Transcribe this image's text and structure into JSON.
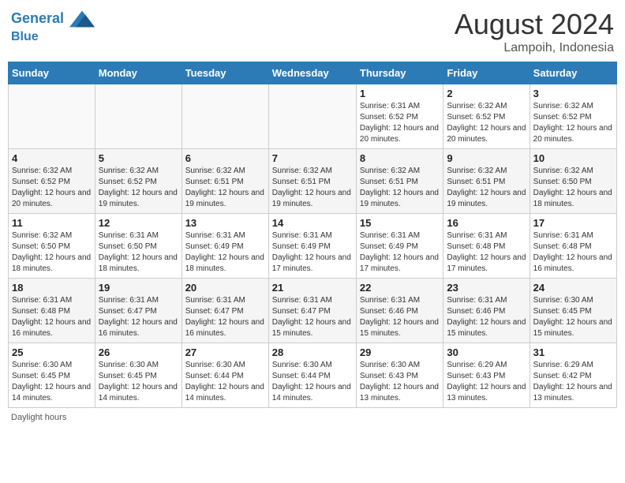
{
  "header": {
    "logo_line1": "General",
    "logo_line2": "Blue",
    "month_year": "August 2024",
    "location": "Lampoih, Indonesia"
  },
  "days_of_week": [
    "Sunday",
    "Monday",
    "Tuesday",
    "Wednesday",
    "Thursday",
    "Friday",
    "Saturday"
  ],
  "weeks": [
    [
      {
        "day": "",
        "info": ""
      },
      {
        "day": "",
        "info": ""
      },
      {
        "day": "",
        "info": ""
      },
      {
        "day": "",
        "info": ""
      },
      {
        "day": "1",
        "info": "Sunrise: 6:31 AM\nSunset: 6:52 PM\nDaylight: 12 hours and 20 minutes."
      },
      {
        "day": "2",
        "info": "Sunrise: 6:32 AM\nSunset: 6:52 PM\nDaylight: 12 hours and 20 minutes."
      },
      {
        "day": "3",
        "info": "Sunrise: 6:32 AM\nSunset: 6:52 PM\nDaylight: 12 hours and 20 minutes."
      }
    ],
    [
      {
        "day": "4",
        "info": "Sunrise: 6:32 AM\nSunset: 6:52 PM\nDaylight: 12 hours and 20 minutes."
      },
      {
        "day": "5",
        "info": "Sunrise: 6:32 AM\nSunset: 6:52 PM\nDaylight: 12 hours and 19 minutes."
      },
      {
        "day": "6",
        "info": "Sunrise: 6:32 AM\nSunset: 6:51 PM\nDaylight: 12 hours and 19 minutes."
      },
      {
        "day": "7",
        "info": "Sunrise: 6:32 AM\nSunset: 6:51 PM\nDaylight: 12 hours and 19 minutes."
      },
      {
        "day": "8",
        "info": "Sunrise: 6:32 AM\nSunset: 6:51 PM\nDaylight: 12 hours and 19 minutes."
      },
      {
        "day": "9",
        "info": "Sunrise: 6:32 AM\nSunset: 6:51 PM\nDaylight: 12 hours and 19 minutes."
      },
      {
        "day": "10",
        "info": "Sunrise: 6:32 AM\nSunset: 6:50 PM\nDaylight: 12 hours and 18 minutes."
      }
    ],
    [
      {
        "day": "11",
        "info": "Sunrise: 6:32 AM\nSunset: 6:50 PM\nDaylight: 12 hours and 18 minutes."
      },
      {
        "day": "12",
        "info": "Sunrise: 6:31 AM\nSunset: 6:50 PM\nDaylight: 12 hours and 18 minutes."
      },
      {
        "day": "13",
        "info": "Sunrise: 6:31 AM\nSunset: 6:49 PM\nDaylight: 12 hours and 18 minutes."
      },
      {
        "day": "14",
        "info": "Sunrise: 6:31 AM\nSunset: 6:49 PM\nDaylight: 12 hours and 17 minutes."
      },
      {
        "day": "15",
        "info": "Sunrise: 6:31 AM\nSunset: 6:49 PM\nDaylight: 12 hours and 17 minutes."
      },
      {
        "day": "16",
        "info": "Sunrise: 6:31 AM\nSunset: 6:48 PM\nDaylight: 12 hours and 17 minutes."
      },
      {
        "day": "17",
        "info": "Sunrise: 6:31 AM\nSunset: 6:48 PM\nDaylight: 12 hours and 16 minutes."
      }
    ],
    [
      {
        "day": "18",
        "info": "Sunrise: 6:31 AM\nSunset: 6:48 PM\nDaylight: 12 hours and 16 minutes."
      },
      {
        "day": "19",
        "info": "Sunrise: 6:31 AM\nSunset: 6:47 PM\nDaylight: 12 hours and 16 minutes."
      },
      {
        "day": "20",
        "info": "Sunrise: 6:31 AM\nSunset: 6:47 PM\nDaylight: 12 hours and 16 minutes."
      },
      {
        "day": "21",
        "info": "Sunrise: 6:31 AM\nSunset: 6:47 PM\nDaylight: 12 hours and 15 minutes."
      },
      {
        "day": "22",
        "info": "Sunrise: 6:31 AM\nSunset: 6:46 PM\nDaylight: 12 hours and 15 minutes."
      },
      {
        "day": "23",
        "info": "Sunrise: 6:31 AM\nSunset: 6:46 PM\nDaylight: 12 hours and 15 minutes."
      },
      {
        "day": "24",
        "info": "Sunrise: 6:30 AM\nSunset: 6:45 PM\nDaylight: 12 hours and 15 minutes."
      }
    ],
    [
      {
        "day": "25",
        "info": "Sunrise: 6:30 AM\nSunset: 6:45 PM\nDaylight: 12 hours and 14 minutes."
      },
      {
        "day": "26",
        "info": "Sunrise: 6:30 AM\nSunset: 6:45 PM\nDaylight: 12 hours and 14 minutes."
      },
      {
        "day": "27",
        "info": "Sunrise: 6:30 AM\nSunset: 6:44 PM\nDaylight: 12 hours and 14 minutes."
      },
      {
        "day": "28",
        "info": "Sunrise: 6:30 AM\nSunset: 6:44 PM\nDaylight: 12 hours and 14 minutes."
      },
      {
        "day": "29",
        "info": "Sunrise: 6:30 AM\nSunset: 6:43 PM\nDaylight: 12 hours and 13 minutes."
      },
      {
        "day": "30",
        "info": "Sunrise: 6:29 AM\nSunset: 6:43 PM\nDaylight: 12 hours and 13 minutes."
      },
      {
        "day": "31",
        "info": "Sunrise: 6:29 AM\nSunset: 6:42 PM\nDaylight: 12 hours and 13 minutes."
      }
    ]
  ],
  "footer": {
    "daylight_label": "Daylight hours"
  }
}
